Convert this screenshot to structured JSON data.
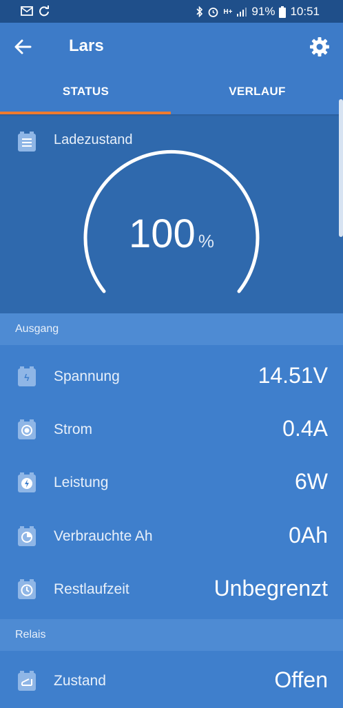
{
  "status_bar": {
    "battery_percent": "91%",
    "time": "10:51",
    "network": "H+"
  },
  "app_bar": {
    "title": "Lars"
  },
  "tabs": [
    {
      "label": "STATUS",
      "active": true
    },
    {
      "label": "VERLAUF",
      "active": false
    }
  ],
  "state_of_charge": {
    "label": "Ladezustand",
    "value": "100",
    "unit": "%"
  },
  "sections": {
    "output": {
      "title": "Ausgang",
      "rows": [
        {
          "label": "Spannung",
          "value": "14.51V",
          "icon": "voltage-icon"
        },
        {
          "label": "Strom",
          "value": "0.4A",
          "icon": "current-icon"
        },
        {
          "label": "Leistung",
          "value": "6W",
          "icon": "power-icon"
        },
        {
          "label": "Verbrauchte Ah",
          "value": "0Ah",
          "icon": "consumed-ah-icon"
        },
        {
          "label": "Restlaufzeit",
          "value": "Unbegrenzt",
          "icon": "time-remaining-icon"
        }
      ]
    },
    "relay": {
      "title": "Relais",
      "rows": [
        {
          "label": "Zustand",
          "value": "Offen",
          "icon": "relay-state-icon"
        }
      ]
    }
  },
  "colors": {
    "accent": "#f07b2e",
    "primary": "#3d7bc8",
    "dark": "#1f4f8a"
  }
}
